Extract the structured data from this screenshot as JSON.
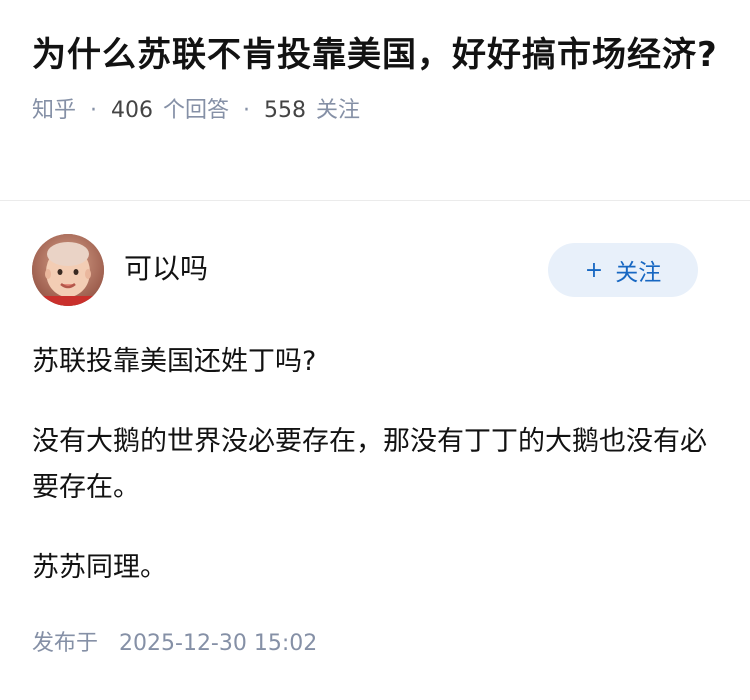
{
  "question": {
    "title": "为什么苏联不肯投靠美国，好好搞市场经济?",
    "source": "知乎",
    "answer_count": "406",
    "answer_label": "个回答",
    "follower_count": "558",
    "follower_label": "关注"
  },
  "answer": {
    "author": {
      "name": "可以吗",
      "avatar_icon": "child-avatar"
    },
    "follow_button": {
      "plus": "+",
      "label": "关注"
    },
    "paragraphs": [
      "苏联投靠美国还姓丁吗?",
      "没有大鹅的世界没必要存在，那没有丁丁的大鹅也没有必要存在。",
      "苏苏同理。"
    ],
    "publish_label": "发布于",
    "publish_time": "2025-12-30 15:02"
  },
  "colors": {
    "meta_gray": "#8590a6",
    "follow_bg": "#e8f0fa",
    "follow_text": "#1767c2"
  }
}
